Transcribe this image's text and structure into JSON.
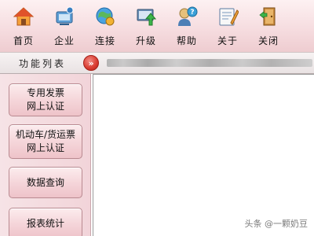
{
  "toolbar": {
    "items": [
      {
        "label": "首页",
        "icon": "home-icon"
      },
      {
        "label": "企业",
        "icon": "enterprise-icon"
      },
      {
        "label": "连接",
        "icon": "connect-icon"
      },
      {
        "label": "升级",
        "icon": "upgrade-icon"
      },
      {
        "label": "帮助",
        "icon": "help-icon"
      },
      {
        "label": "关于",
        "icon": "about-icon"
      },
      {
        "label": "关闭",
        "icon": "close-icon"
      }
    ]
  },
  "function_bar": {
    "title": "功能列表",
    "toggle_glyph": "»"
  },
  "sidebar": {
    "buttons": [
      {
        "line1": "专用发票",
        "line2": "网上认证"
      },
      {
        "line1": "机动车/货运票",
        "line2": "网上认证"
      },
      {
        "line1": "数据查询",
        "line2": ""
      },
      {
        "line1": "报表统计",
        "line2": ""
      }
    ]
  },
  "watermark": "头条 @一颗奶豆",
  "colors": {
    "toolbar_bg": "#f6dde0",
    "sidebar_bg": "#f2d4d9",
    "button_border": "#b98a91",
    "chevron_red": "#d83a2f"
  }
}
